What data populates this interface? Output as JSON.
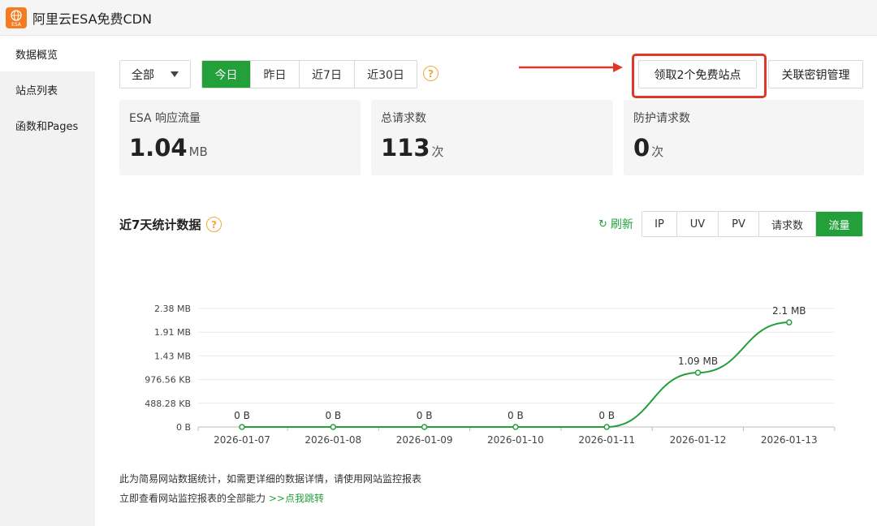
{
  "app": {
    "title": "阿里云ESA免费CDN",
    "logo_text": "ESA"
  },
  "sidebar": {
    "items": [
      {
        "label": "数据概览",
        "active": true
      },
      {
        "label": "站点列表",
        "active": false
      },
      {
        "label": "函数和Pages",
        "active": false
      }
    ]
  },
  "toolbar": {
    "scope_select": "全部",
    "range_tabs": [
      "今日",
      "昨日",
      "近7日",
      "近30日"
    ],
    "range_selected": "今日",
    "claim_button": "领取2个免费站点",
    "key_button": "关联密钥管理",
    "help_glyph": "?"
  },
  "cards": [
    {
      "label": "ESA 响应流量",
      "value": "1.04",
      "unit": "MB"
    },
    {
      "label": "总请求数",
      "value": "113",
      "unit": "次"
    },
    {
      "label": "防护请求数",
      "value": "0",
      "unit": "次"
    }
  ],
  "stats": {
    "title": "近7天统计数据",
    "refresh_label": "刷新",
    "refresh_icon": "↻",
    "metric_tabs": [
      "IP",
      "UV",
      "PV",
      "请求数",
      "流量"
    ],
    "metric_selected": "流量"
  },
  "chart_data": {
    "type": "line",
    "x": [
      "2026-01-07",
      "2026-01-08",
      "2026-01-09",
      "2026-01-10",
      "2026-01-11",
      "2026-01-12",
      "2026-01-13"
    ],
    "values_mb": [
      0,
      0,
      0,
      0,
      0,
      1.09,
      2.1
    ],
    "data_labels": [
      "0 B",
      "0 B",
      "0 B",
      "0 B",
      "0 B",
      "1.09 MB",
      "2.1 MB"
    ],
    "y_ticks": [
      "0 B",
      "488.28 KB",
      "976.56 KB",
      "1.43 MB",
      "1.91 MB",
      "2.38 MB"
    ],
    "ylim_mb": [
      0,
      2.38
    ],
    "grid": true,
    "color": "#23a03a"
  },
  "footer": {
    "line1": "此为简易网站数据统计，如需更详细的数据详情，请使用网站监控报表",
    "line2_text": "立即查看网站监控报表的全部能力",
    "line2_link": ">>点我跳转"
  },
  "colors": {
    "accent": "#23a03a",
    "highlight": "#e0372b",
    "help": "#f0a93a",
    "logo": "#f47b20"
  }
}
